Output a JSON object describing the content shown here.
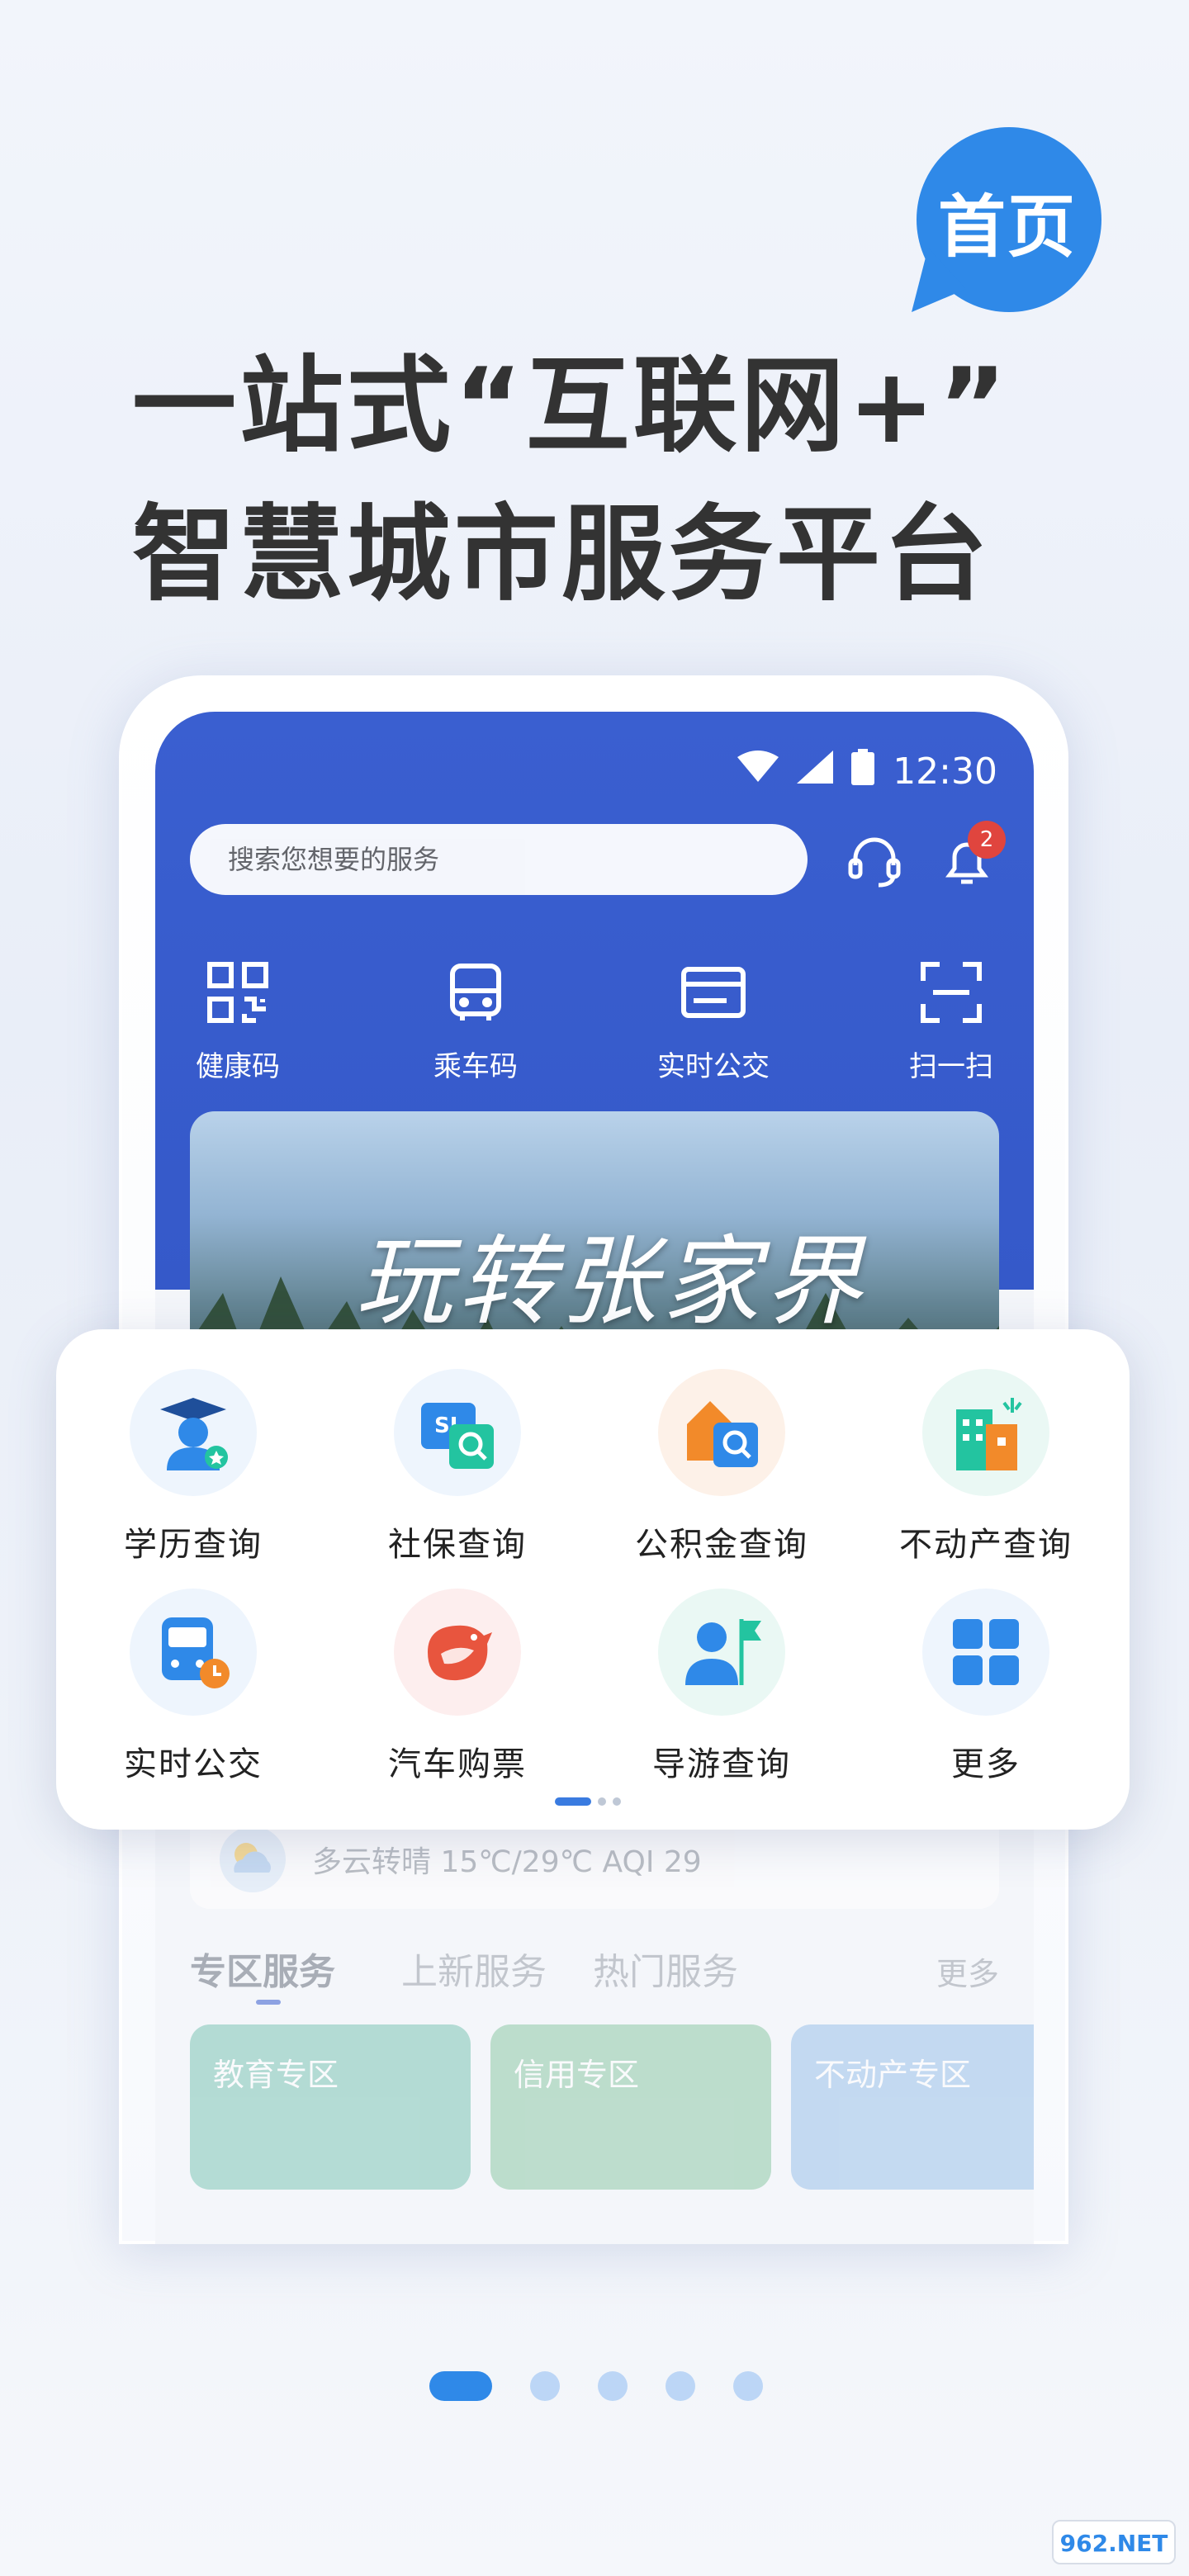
{
  "promo": {
    "bubble": "首页",
    "headline_line1": "一站式“互联网+”",
    "headline_line2": "智慧城市服务平台"
  },
  "status_bar": {
    "time": "12:30"
  },
  "header": {
    "search_placeholder": "搜索您想要的服务",
    "notification_count": "2"
  },
  "quick_actions": [
    {
      "label": "健康码",
      "icon": "qr-code-icon"
    },
    {
      "label": "乘车码",
      "icon": "bus-code-icon"
    },
    {
      "label": "实时公交",
      "icon": "bus-card-icon"
    },
    {
      "label": "扫一扫",
      "icon": "scan-icon"
    }
  ],
  "banner": {
    "title": "玩转张家界"
  },
  "services": [
    {
      "label": "学历查询",
      "icon": "graduate-icon",
      "color": "#2f89e8"
    },
    {
      "label": "社保查询",
      "icon": "social-security-icon",
      "color": "#2f89e8"
    },
    {
      "label": "公积金查询",
      "icon": "housing-fund-icon",
      "color": "#f28a2a"
    },
    {
      "label": "不动产查询",
      "icon": "real-estate-icon",
      "color": "#f28a2a"
    },
    {
      "label": "实时公交",
      "icon": "bus-icon",
      "color": "#2f89e8"
    },
    {
      "label": "汽车购票",
      "icon": "bird-ticket-icon",
      "color": "#e8553e"
    },
    {
      "label": "导游查询",
      "icon": "guide-flag-icon",
      "color": "#2f89e8"
    },
    {
      "label": "更多",
      "icon": "grid-more-icon",
      "color": "#2f89e8"
    }
  ],
  "weather": {
    "text": "多云转晴 15℃/29℃ AQI 29"
  },
  "tabs": {
    "items": [
      "专区服务",
      "上新服务",
      "热门服务"
    ],
    "more": "更多"
  },
  "zones": [
    "教育专区",
    "信用专区",
    "不动产专区"
  ],
  "watermark": "962.NET",
  "colors": {
    "primary": "#3a5fd0",
    "accent": "#2f89e8"
  }
}
